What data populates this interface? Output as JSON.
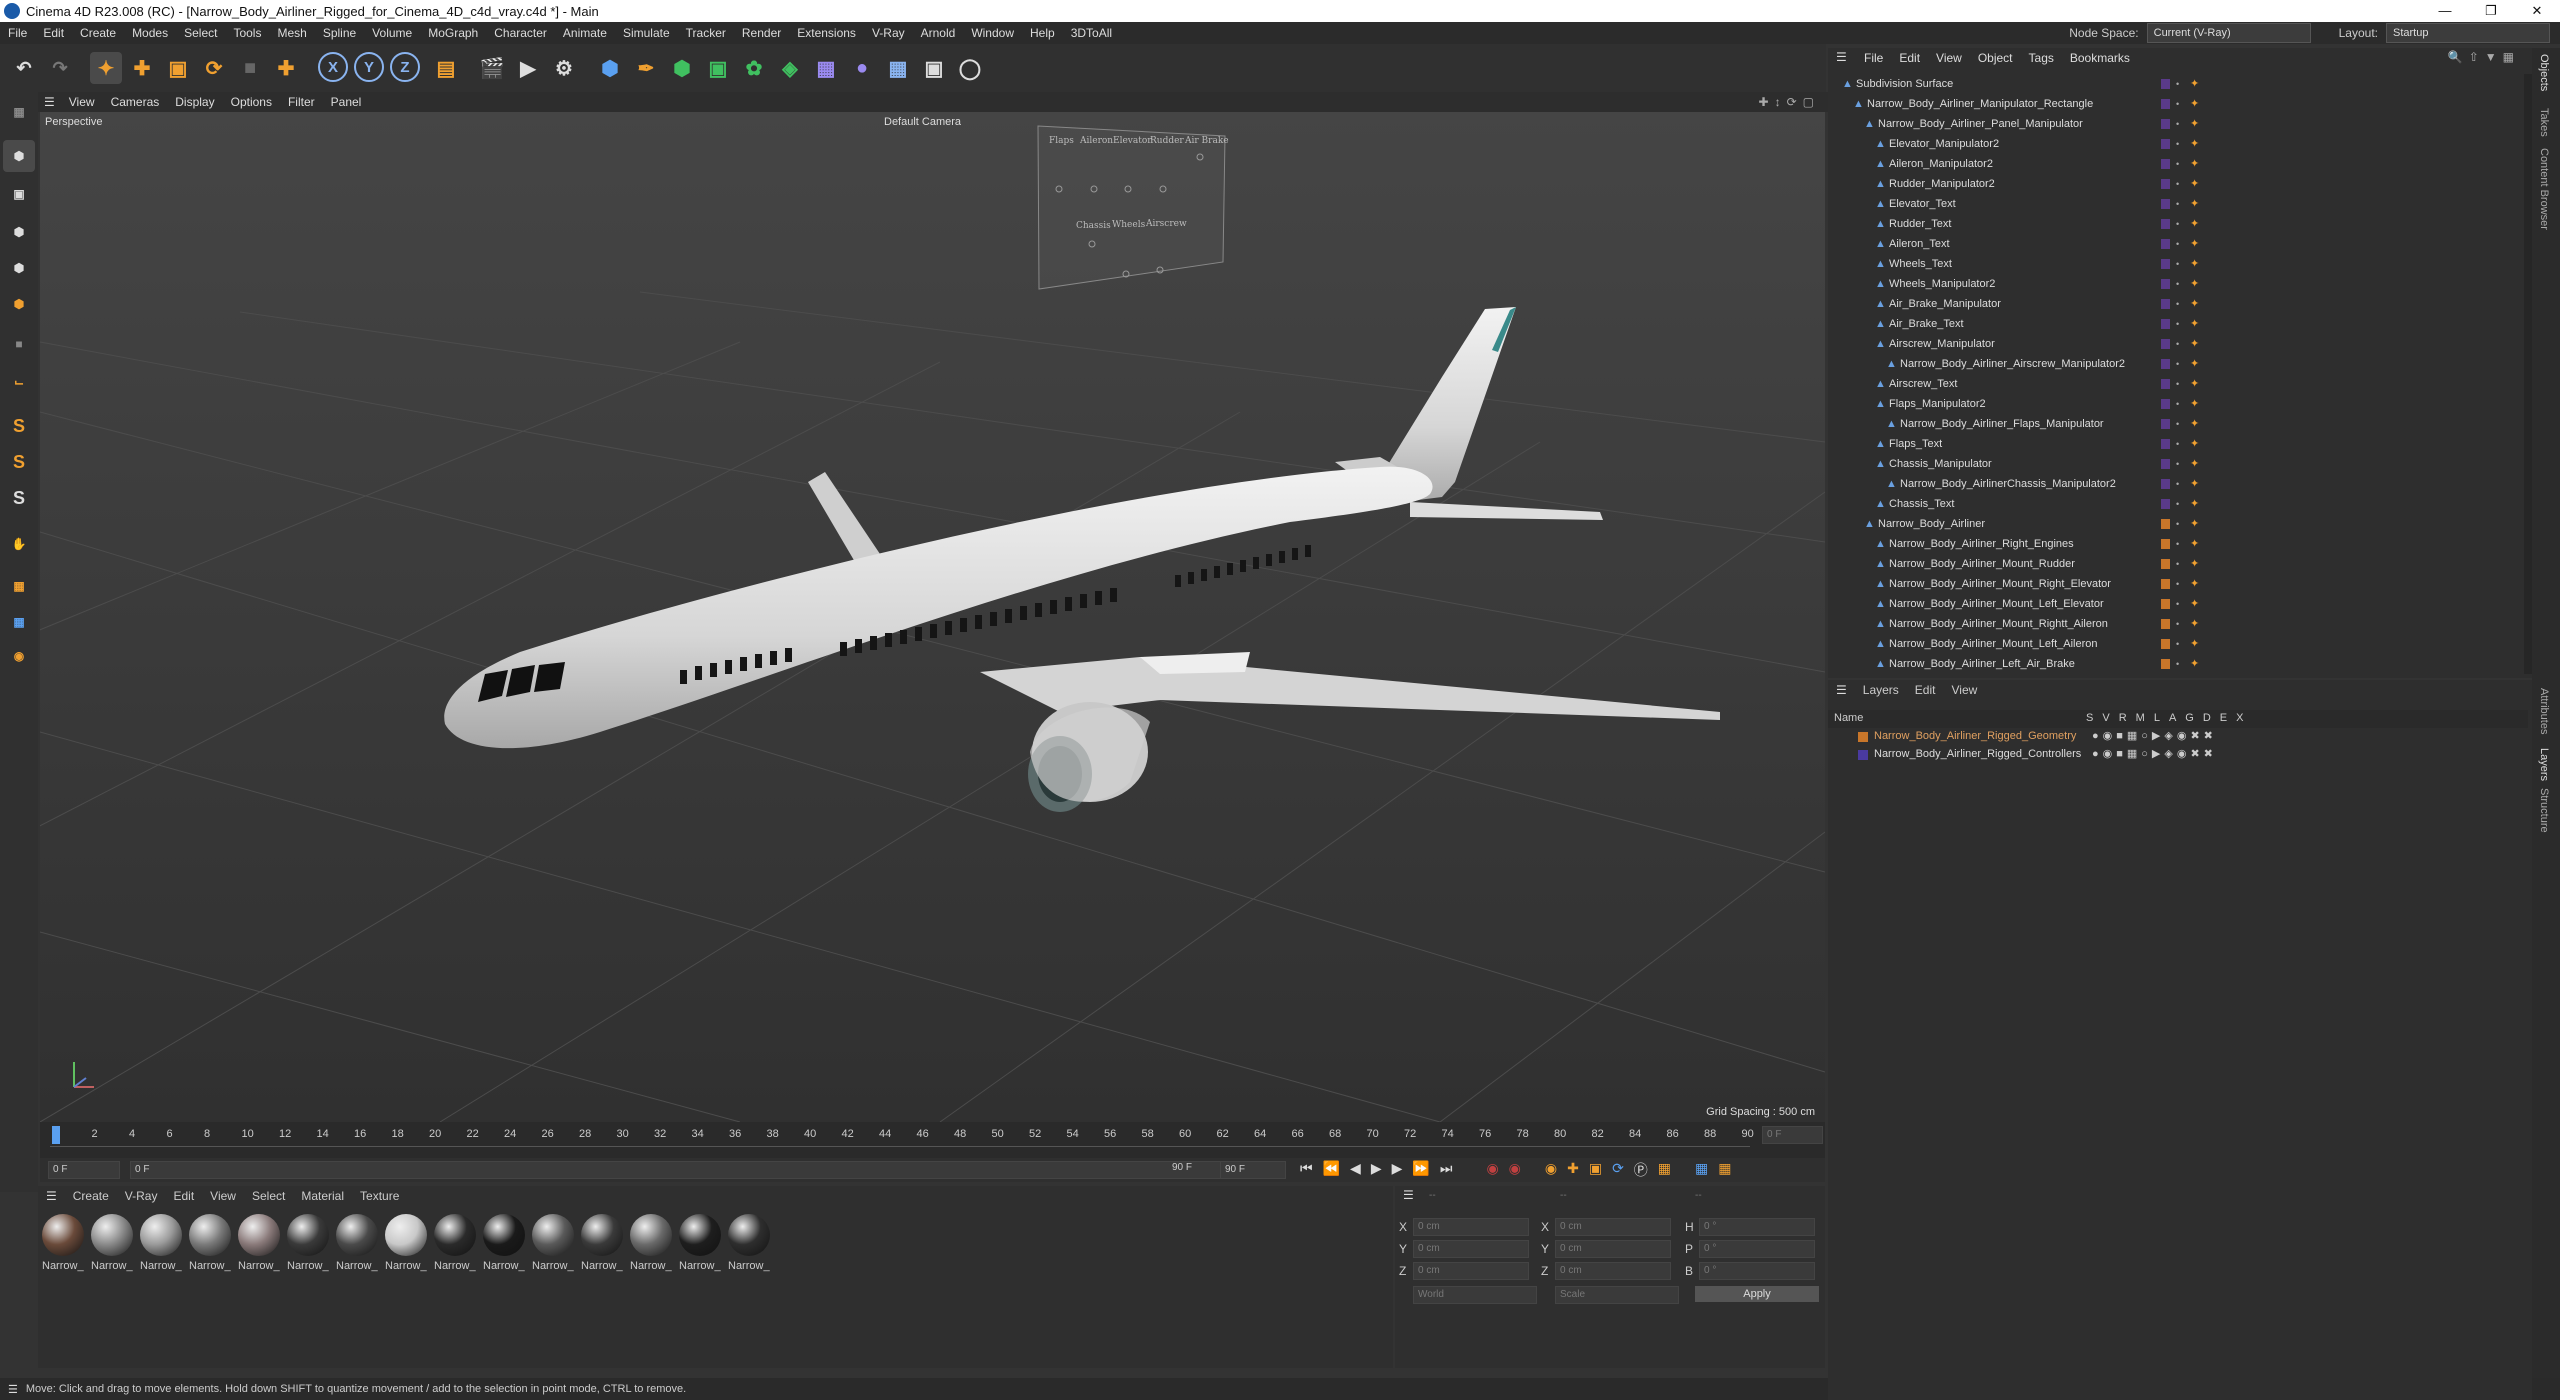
{
  "window": {
    "title": "Cinema 4D R23.008 (RC) - [Narrow_Body_Airliner_Rigged_for_Cinema_4D_c4d_vray.c4d *] - Main"
  },
  "menubar": {
    "items": [
      "File",
      "Edit",
      "Create",
      "Modes",
      "Select",
      "Tools",
      "Mesh",
      "Spline",
      "Volume",
      "MoGraph",
      "Character",
      "Animate",
      "Simulate",
      "Tracker",
      "Render",
      "Extensions",
      "V-Ray",
      "Arnold",
      "Window",
      "Help",
      "3DToAll"
    ],
    "node_space_label": "Node Space:",
    "node_space_value": "Current (V-Ray)",
    "layout_label": "Layout:",
    "layout_value": "Startup"
  },
  "viewport": {
    "menu": [
      "View",
      "Cameras",
      "Display",
      "Options",
      "Filter",
      "Panel"
    ],
    "view_name": "Perspective",
    "camera": "Default Camera",
    "grid_spacing": "Grid Spacing : 500 cm",
    "panel_labels_top": [
      "Flaps",
      "Aileron",
      "Elevator",
      "Rudder",
      "Air Brake"
    ],
    "panel_labels_bottom": [
      "Chassis",
      "Wheels",
      "Airscrew"
    ]
  },
  "timeline": {
    "ticks": [
      "0",
      "2",
      "4",
      "6",
      "8",
      "10",
      "12",
      "14",
      "16",
      "18",
      "20",
      "22",
      "24",
      "26",
      "28",
      "30",
      "32",
      "34",
      "36",
      "38",
      "40",
      "42",
      "44",
      "46",
      "48",
      "50",
      "52",
      "54",
      "56",
      "58",
      "60",
      "62",
      "64",
      "66",
      "68",
      "70",
      "72",
      "74",
      "76",
      "78",
      "80",
      "82",
      "84",
      "86",
      "88",
      "90"
    ],
    "current_frame": "0 F",
    "start": "0 F",
    "start2": "0 F",
    "end": "90 F",
    "end2": "90 F"
  },
  "materials": {
    "menu": [
      "Create",
      "V-Ray",
      "Edit",
      "View",
      "Select",
      "Material",
      "Texture"
    ],
    "items": [
      "Narrow_",
      "Narrow_",
      "Narrow_",
      "Narrow_",
      "Narrow_",
      "Narrow_",
      "Narrow_",
      "Narrow_",
      "Narrow_",
      "Narrow_",
      "Narrow_",
      "Narrow_",
      "Narrow_",
      "Narrow_",
      "Narrow_"
    ]
  },
  "coords": {
    "header1": "--",
    "header2": "--",
    "header3": "--",
    "x_label": "X",
    "y_label": "Y",
    "z_label": "Z",
    "h_label": "H",
    "p_label": "P",
    "b_label": "B",
    "pos_x": "0 cm",
    "pos_y": "0 cm",
    "pos_z": "0 cm",
    "size_x": "0 cm",
    "size_y": "0 cm",
    "size_z": "0 cm",
    "rot_h": "0 °",
    "rot_p": "0 °",
    "rot_b": "0 °",
    "mode1": "World",
    "mode2": "Scale",
    "apply": "Apply"
  },
  "objects": {
    "menu": [
      "File",
      "Edit",
      "View",
      "Object",
      "Tags",
      "Bookmarks"
    ],
    "rows": [
      {
        "name": "Subdivision Surface",
        "indent": 0
      },
      {
        "name": "Narrow_Body_Airliner_Manipulator_Rectangle",
        "indent": 1
      },
      {
        "name": "Narrow_Body_Airliner_Panel_Manipulator",
        "indent": 2
      },
      {
        "name": "Elevator_Manipulator2",
        "indent": 3
      },
      {
        "name": "Aileron_Manipulator2",
        "indent": 3
      },
      {
        "name": "Rudder_Manipulator2",
        "indent": 3
      },
      {
        "name": "Elevator_Text",
        "indent": 3
      },
      {
        "name": "Rudder_Text",
        "indent": 3
      },
      {
        "name": "Aileron_Text",
        "indent": 3
      },
      {
        "name": "Wheels_Text",
        "indent": 3
      },
      {
        "name": "Wheels_Manipulator2",
        "indent": 3
      },
      {
        "name": "Air_Brake_Manipulator",
        "indent": 3
      },
      {
        "name": "Air_Brake_Text",
        "indent": 3
      },
      {
        "name": "Airscrew_Manipulator",
        "indent": 3
      },
      {
        "name": "Narrow_Body_Airliner_Airscrew_Manipulator2",
        "indent": 4
      },
      {
        "name": "Airscrew_Text",
        "indent": 3
      },
      {
        "name": "Flaps_Manipulator2",
        "indent": 3
      },
      {
        "name": "Narrow_Body_Airliner_Flaps_Manipulator",
        "indent": 4
      },
      {
        "name": "Flaps_Text",
        "indent": 3
      },
      {
        "name": "Chassis_Manipulator",
        "indent": 3
      },
      {
        "name": "Narrow_Body_AirlinerChassis_Manipulator2",
        "indent": 4
      },
      {
        "name": "Chassis_Text",
        "indent": 3
      },
      {
        "name": "Narrow_Body_Airliner",
        "indent": 2
      },
      {
        "name": "Narrow_Body_Airliner_Right_Engines",
        "indent": 3
      },
      {
        "name": "Narrow_Body_Airliner_Mount_Rudder",
        "indent": 3
      },
      {
        "name": "Narrow_Body_Airliner_Mount_Right_Elevator",
        "indent": 3
      },
      {
        "name": "Narrow_Body_Airliner_Mount_Left_Elevator",
        "indent": 3
      },
      {
        "name": "Narrow_Body_Airliner_Mount_Rightt_Aileron",
        "indent": 3
      },
      {
        "name": "Narrow_Body_Airliner_Mount_Left_Aileron",
        "indent": 3
      },
      {
        "name": "Narrow_Body_Airliner_Left_Air_Brake",
        "indent": 3
      }
    ]
  },
  "layers": {
    "menu": [
      "Layers",
      "Edit",
      "View"
    ],
    "name_header": "Name",
    "col_headers": [
      "S",
      "V",
      "R",
      "M",
      "L",
      "A",
      "G",
      "D",
      "E",
      "X"
    ],
    "rows": [
      {
        "name": "Narrow_Body_Airliner_Rigged_Geometry",
        "color": "#c8762a"
      },
      {
        "name": "Narrow_Body_Airliner_Rigged_Controllers",
        "color": "#4a3aa0"
      }
    ]
  },
  "side_tabs": [
    "Objects",
    "Takes",
    "Content Browser",
    "Attributes",
    "Layers",
    "Structure"
  ],
  "status": "Move: Click and drag to move elements. Hold down SHIFT to quantize movement / add to the selection in point mode, CTRL to remove.",
  "colors": {
    "accent": "#f0a030",
    "selected_layer": "#e0a060"
  }
}
